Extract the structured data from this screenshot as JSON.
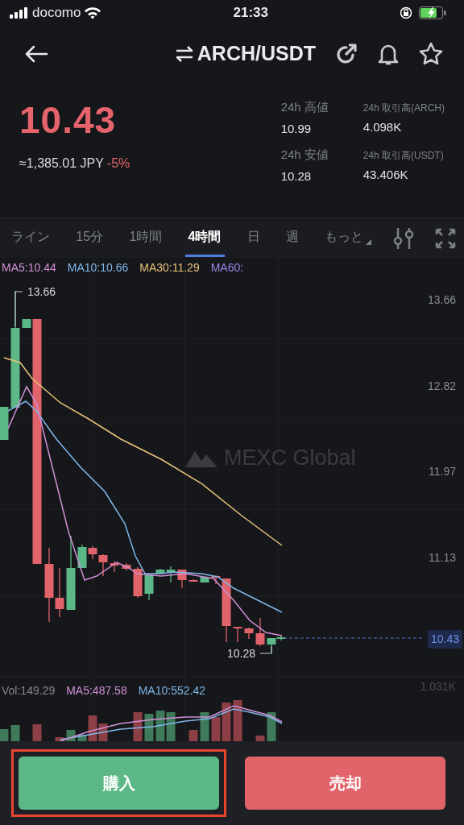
{
  "status_bar": {
    "carrier": "docomo",
    "time": "21:33"
  },
  "header": {
    "pair": "ARCH/USDT"
  },
  "price": {
    "last": "10.43",
    "approx": "≈1,385.01 JPY",
    "change": "-5%"
  },
  "stats": [
    {
      "label": "24h 高値",
      "value": "10.99",
      "kind": "price"
    },
    {
      "label": "24h 取引高(ARCH)",
      "value": "4.098K",
      "kind": "volume"
    },
    {
      "label": "24h 安値",
      "value": "10.28",
      "kind": "price"
    },
    {
      "label": "24h 取引高(USDT)",
      "value": "43.406K",
      "kind": "volume"
    }
  ],
  "tabs": [
    {
      "label": "ライン",
      "selected": false
    },
    {
      "label": "15分",
      "selected": false
    },
    {
      "label": "1時間",
      "selected": false
    },
    {
      "label": "4時間",
      "selected": true
    },
    {
      "label": "日",
      "selected": false
    },
    {
      "label": "週",
      "selected": false
    },
    {
      "label": "もっと",
      "selected": false,
      "kind": "dropdown"
    }
  ],
  "chart": {
    "legend": [
      {
        "label": "MA5:10.44",
        "color": "#d08fd6"
      },
      {
        "label": "MA10:10.66",
        "color": "#7fb7e8"
      },
      {
        "label": "MA30:11.29",
        "color": "#e8c37a"
      },
      {
        "label": "MA60:",
        "color": "#9b87e8"
      }
    ],
    "price_ticks": [
      "13.66",
      "12.82",
      "11.97",
      "11.13"
    ],
    "high_label": "13.66",
    "low_label": "10.28",
    "current_price": "10.43",
    "watermark": "MEXC Global",
    "volume_legend": [
      {
        "label": "Vol:149.29",
        "color": "#85888e"
      },
      {
        "label": "MA5:487.58",
        "color": "#d08fd6"
      },
      {
        "label": "MA10:552.42",
        "color": "#7fb7e8"
      }
    ],
    "volume_tick": "1.031K"
  },
  "buttons": [
    {
      "label": "購入",
      "kind": "buy",
      "highlighted": true
    },
    {
      "label": "売却",
      "kind": "sell",
      "highlighted": false
    }
  ]
}
